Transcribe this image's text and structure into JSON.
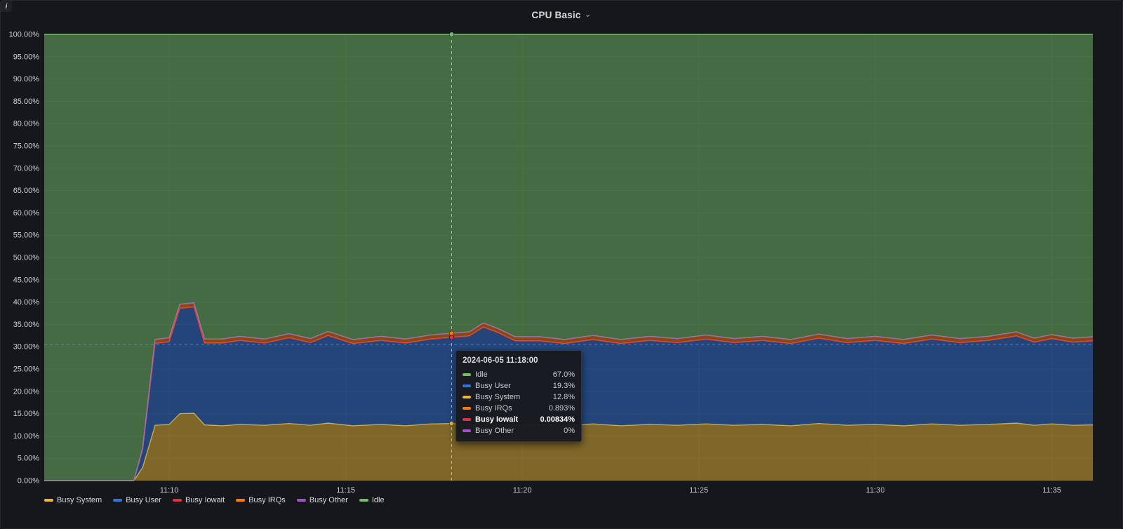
{
  "panel": {
    "title": "CPU Basic",
    "chevron": "⌄",
    "info_icon": "i"
  },
  "tooltip": {
    "timestamp": "2024-06-05 11:18:00",
    "rows": [
      {
        "name": "Idle",
        "value": "67.0%",
        "color": "#73BF69",
        "bold": false
      },
      {
        "name": "Busy User",
        "value": "19.3%",
        "color": "#3274D9",
        "bold": false
      },
      {
        "name": "Busy System",
        "value": "12.8%",
        "color": "#EAB839",
        "bold": false
      },
      {
        "name": "Busy IRQs",
        "value": "0.893%",
        "color": "#FF780A",
        "bold": false
      },
      {
        "name": "Busy Iowait",
        "value": "0.00834%",
        "color": "#E02F44",
        "bold": true
      },
      {
        "name": "Busy Other",
        "value": "0%",
        "color": "#A352CC",
        "bold": false
      }
    ]
  },
  "legend": [
    {
      "label": "Busy System",
      "color": "#EAB839"
    },
    {
      "label": "Busy User",
      "color": "#3274D9"
    },
    {
      "label": "Busy Iowait",
      "color": "#E02F44"
    },
    {
      "label": "Busy IRQs",
      "color": "#FF780A"
    },
    {
      "label": "Busy Other",
      "color": "#A352CC"
    },
    {
      "label": "Idle",
      "color": "#73BF69"
    }
  ],
  "chart_data": {
    "type": "area",
    "stacked": true,
    "title": "CPU Basic",
    "unit": "percent",
    "ylim": [
      0,
      100
    ],
    "grid": true,
    "legend_position": "bottom",
    "x_range_minutes": [
      6.46,
      36.16
    ],
    "x_tick_minutes": [
      10,
      15,
      20,
      25,
      30,
      35
    ],
    "x_tick_labels": [
      "11:10",
      "11:15",
      "11:20",
      "11:25",
      "11:30",
      "11:35"
    ],
    "y_tick_labels": [
      "0.00%",
      "5.00%",
      "10.00%",
      "15.00%",
      "20.00%",
      "25.00%",
      "30.00%",
      "35.00%",
      "40.00%",
      "45.00%",
      "50.00%",
      "55.00%",
      "60.00%",
      "65.00%",
      "70.00%",
      "75.00%",
      "80.00%",
      "85.00%",
      "90.00%",
      "95.00%",
      "100.00%"
    ],
    "x_minutes": [
      6.46,
      8.5,
      9.0,
      9.25,
      9.6,
      10.0,
      10.3,
      10.7,
      11.0,
      11.5,
      12.0,
      12.7,
      13.4,
      14.0,
      14.5,
      15.2,
      16.0,
      16.7,
      17.4,
      18.0,
      18.5,
      18.9,
      19.3,
      19.8,
      20.5,
      21.2,
      22.0,
      22.8,
      23.6,
      24.4,
      25.2,
      26.0,
      26.8,
      27.6,
      28.4,
      29.2,
      30.0,
      30.8,
      31.6,
      32.4,
      33.2,
      34.0,
      34.5,
      35.0,
      35.6,
      36.16
    ],
    "series": [
      {
        "name": "Busy System",
        "color": "#EAB839",
        "values": [
          0,
          0,
          0,
          3,
          12.4,
          12.6,
          15.0,
          15.1,
          12.5,
          12.3,
          12.6,
          12.4,
          12.8,
          12.4,
          12.9,
          12.3,
          12.6,
          12.3,
          12.7,
          12.8,
          12.5,
          13.0,
          12.6,
          12.4,
          12.6,
          12.3,
          12.7,
          12.3,
          12.6,
          12.4,
          12.7,
          12.4,
          12.6,
          12.3,
          12.8,
          12.4,
          12.6,
          12.3,
          12.7,
          12.4,
          12.6,
          12.9,
          12.4,
          12.7,
          12.4,
          12.5
        ]
      },
      {
        "name": "Busy User",
        "color": "#3274D9",
        "values": [
          0,
          0,
          0,
          4,
          18.3,
          18.5,
          23.6,
          23.8,
          18.3,
          18.5,
          18.8,
          18.4,
          19.2,
          18.5,
          19.6,
          18.4,
          18.8,
          18.5,
          19.0,
          19.3,
          19.9,
          21.4,
          20.6,
          18.9,
          18.7,
          18.4,
          18.9,
          18.4,
          18.8,
          18.5,
          19.0,
          18.5,
          18.8,
          18.4,
          19.1,
          18.5,
          18.8,
          18.4,
          19.0,
          18.5,
          18.8,
          19.5,
          18.6,
          19.1,
          18.6,
          18.8
        ]
      },
      {
        "name": "Busy Iowait",
        "color": "#E02F44",
        "values": [
          0,
          0,
          0,
          0.01,
          0.01,
          0.01,
          0.01,
          0.01,
          0.01,
          0.01,
          0.01,
          0.01,
          0.01,
          0.01,
          0.01,
          0.01,
          0.01,
          0.01,
          0.01,
          0.01,
          0.01,
          0.01,
          0.01,
          0.01,
          0.01,
          0.01,
          0.01,
          0.01,
          0.01,
          0.01,
          0.01,
          0.01,
          0.01,
          0.01,
          0.01,
          0.01,
          0.01,
          0.01,
          0.01,
          0.01,
          0.01,
          0.01,
          0.01,
          0.01,
          0.01,
          0.01
        ]
      },
      {
        "name": "Busy IRQs",
        "color": "#FF780A",
        "values": [
          0,
          0,
          0,
          0.3,
          0.9,
          0.9,
          0.9,
          0.9,
          0.9,
          0.9,
          0.9,
          0.9,
          0.9,
          0.9,
          0.9,
          0.9,
          0.9,
          0.9,
          0.9,
          0.9,
          0.9,
          0.9,
          0.9,
          0.9,
          0.9,
          0.9,
          0.9,
          0.9,
          0.9,
          0.9,
          0.9,
          0.9,
          0.9,
          0.9,
          0.9,
          0.9,
          0.9,
          0.9,
          0.9,
          0.9,
          0.9,
          0.9,
          0.9,
          0.9,
          0.9,
          0.9
        ]
      },
      {
        "name": "Busy Other",
        "color": "#A352CC",
        "values": [
          0,
          0,
          0,
          0,
          0,
          0,
          0,
          0,
          0,
          0,
          0,
          0,
          0,
          0,
          0,
          0,
          0,
          0,
          0,
          0,
          0,
          0,
          0,
          0,
          0,
          0,
          0,
          0,
          0,
          0,
          0,
          0,
          0,
          0,
          0,
          0,
          0,
          0,
          0,
          0,
          0,
          0,
          0,
          0,
          0,
          0
        ]
      },
      {
        "name": "Idle",
        "color": "#73BF69",
        "values": [
          100,
          100,
          100,
          92.69,
          68.39,
          67.99,
          60.49,
          60.19,
          68.29,
          68.29,
          67.69,
          68.29,
          67.09,
          68.19,
          66.59,
          68.39,
          67.69,
          68.29,
          67.39,
          66.99,
          66.69,
          64.69,
          65.89,
          67.79,
          67.79,
          68.39,
          67.49,
          68.39,
          67.69,
          68.19,
          67.39,
          68.19,
          67.69,
          68.39,
          67.19,
          68.19,
          67.69,
          68.39,
          67.39,
          68.19,
          67.69,
          66.69,
          68.09,
          67.29,
          68.09,
          67.79
        ]
      }
    ],
    "crosshair": {
      "x_minute": 18,
      "y_percent": 30.5,
      "points": [
        {
          "color": "#73BF69",
          "percent": 100
        },
        {
          "color": "#FF780A",
          "percent": 33.0
        },
        {
          "color": "#3274D9",
          "percent": 32.1
        },
        {
          "color": "#E02F44",
          "percent": 32.11
        },
        {
          "color": "#EAB839",
          "percent": 12.8
        }
      ]
    }
  }
}
